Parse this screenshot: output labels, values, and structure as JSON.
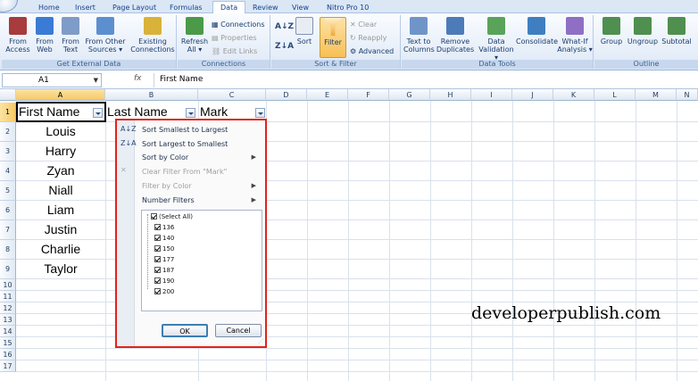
{
  "tabs": [
    "Home",
    "Insert",
    "Page Layout",
    "Formulas",
    "Data",
    "Review",
    "View",
    "Nitro Pro 10"
  ],
  "active_tab": "Data",
  "ribbon": {
    "get_external": {
      "buttons": [
        {
          "line1": "From",
          "line2": "Access",
          "icon": "access-icon",
          "color": "#a83b3b"
        },
        {
          "line1": "From",
          "line2": "Web",
          "icon": "web-icon",
          "color": "#3a7bd5"
        },
        {
          "line1": "From",
          "line2": "Text",
          "icon": "text-file-icon",
          "color": "#7e9cc7"
        },
        {
          "line1": "From Other",
          "line2": "Sources ▾",
          "icon": "other-sources-icon",
          "color": "#5c8fd0"
        },
        {
          "line1": "Existing",
          "line2": "Connections",
          "icon": "connections-icon",
          "color": "#d9b23a"
        }
      ],
      "label": "Get External Data"
    },
    "connections": {
      "refresh": {
        "line1": "Refresh",
        "line2": "All ▾"
      },
      "items": [
        "Connections",
        "Properties",
        "Edit Links"
      ],
      "label": "Connections"
    },
    "sort_filter": {
      "sort_az": "A↓Z",
      "sort_za": "Z↓A",
      "sort_label": "Sort",
      "filter_label": "Filter",
      "items": [
        "Clear",
        "Reapply",
        "Advanced"
      ],
      "label": "Sort & Filter"
    },
    "data_tools": {
      "buttons": [
        {
          "line1": "Text to",
          "line2": "Columns"
        },
        {
          "line1": "Remove",
          "line2": "Duplicates"
        },
        {
          "line1": "Data",
          "line2": "Validation ▾"
        },
        {
          "line1": "Consolidate",
          "line2": ""
        },
        {
          "line1": "What-If",
          "line2": "Analysis ▾"
        }
      ],
      "label": "Data Tools"
    },
    "outline": {
      "buttons": [
        "Group",
        "Ungroup",
        "Subtotal"
      ],
      "label": "Outline"
    }
  },
  "formula_bar": {
    "name_box": "A1",
    "fx": "fx",
    "value": "First Name"
  },
  "columns": [
    "A",
    "B",
    "C",
    "D",
    "E",
    "F",
    "G",
    "H",
    "I",
    "J",
    "K",
    "L",
    "M",
    "N"
  ],
  "rows": [
    "1",
    "2",
    "3",
    "4",
    "5",
    "6",
    "7",
    "8",
    "9",
    "10",
    "11",
    "12",
    "13",
    "14",
    "15",
    "16",
    "17"
  ],
  "headers": {
    "a": "First Name",
    "b": "Last Name",
    "c": "Mark"
  },
  "names": [
    "Louis",
    "Harry",
    "Zyan",
    "Niall",
    "Liam",
    "Justin",
    "Charlie",
    "Taylor"
  ],
  "filter_menu": {
    "sort_asc": "Sort Smallest to Largest",
    "sort_desc": "Sort Largest to Smallest",
    "sort_color": "Sort by Color",
    "clear_filter": "Clear Filter From \"Mark\"",
    "filter_color": "Filter by Color",
    "number_filters": "Number Filters",
    "list": [
      "(Select All)",
      "136",
      "140",
      "150",
      "177",
      "187",
      "190",
      "200"
    ],
    "ok": "OK",
    "cancel": "Cancel"
  },
  "watermark": "developerpublish.com",
  "colors": {
    "accent": "#f7c968",
    "popup_border": "#e2231a",
    "ribbon": "#dde8f6"
  }
}
